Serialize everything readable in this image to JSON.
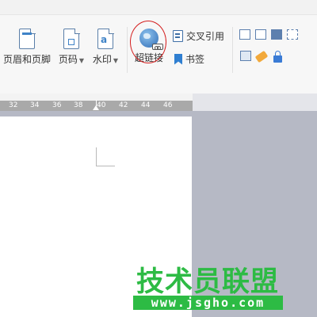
{
  "ribbon": {
    "header_footer": "页眉和页脚",
    "page_number": "页码",
    "watermark": "水印",
    "hyperlink": "超链接",
    "cross_reference": "交叉引用",
    "bookmark": "书签"
  },
  "ruler": {
    "ticks": [
      "32",
      "34",
      "36",
      "38",
      "40",
      "42",
      "44",
      "46"
    ]
  },
  "watermark_site": {
    "title": "技术员联盟",
    "url": "www.jsgho.com"
  },
  "colors": {
    "highlight_circle": "#d41f1f",
    "watermark_green": "#2dbb44"
  }
}
